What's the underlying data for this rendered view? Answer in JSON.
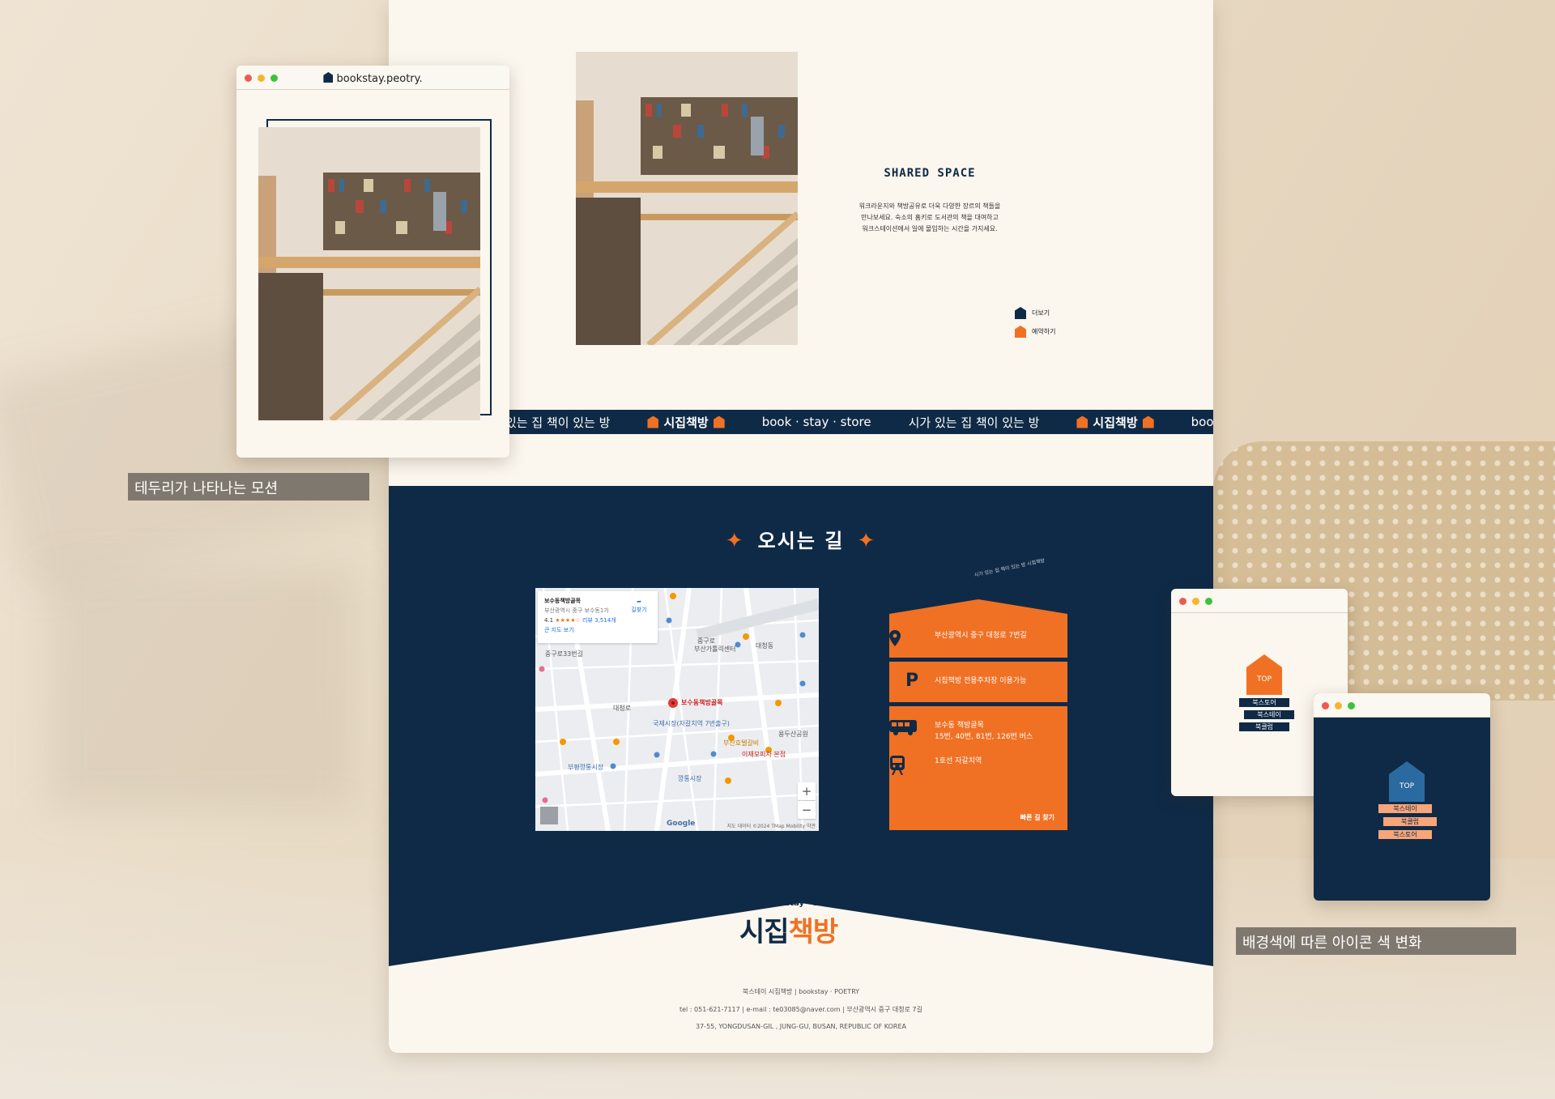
{
  "colors": {
    "navy": "#0f2a46",
    "orange": "#f07124",
    "cream": "#fbf6ee",
    "caption_bg": "#7f786e"
  },
  "shared": {
    "title": "SHARED SPACE",
    "desc": [
      "워크라운지와 책방공유로 더욱 다양한 장르의 책들을",
      "만나보세요. 숙소의 홈키로 도서관의 책을 대여하고",
      "워크스테이션에서 일에 몰입하는 시간을 가지세요."
    ],
    "more_label": "더보기",
    "reserve_label": "예약하기"
  },
  "ticker": {
    "items": [
      "있는 집 책이 있는 방",
      "시집책방",
      "book · stay · store",
      "시가 있는 집 책이 있는 방",
      "시집책방",
      "book · stay · s"
    ]
  },
  "directions": {
    "title": "오시는 길",
    "map": {
      "place_name": "보수동책방골목",
      "address": "부산광역시 중구 보수동1가",
      "rating": "4.1",
      "stars": "★★★★☆",
      "review_count": "리뷰 3,514개",
      "larger_map": "큰 지도 보기",
      "route_label": "길찾기",
      "pin_label": "보수동책방골목",
      "labels": [
        "대청로",
        "중구로",
        "부산가톨릭센터",
        "국제시장(자갈치역 7번출구)",
        "부산호텔갈비",
        "깡통시장",
        "부평깡통시장",
        "대청동",
        "중구로33번길",
        "이재모피자 본점",
        "용두산공원"
      ],
      "google": "Google",
      "footer": "지도 데이터 ©2024 TMap Mobility   약관"
    },
    "info": {
      "curve_text": "시가 있는 집 책이 있는 방 시집책방",
      "address": "부산광역시 중구 대청로 7번길",
      "parking": "시집책방 전용주차장 이용가능",
      "bus_stop": "보수동 책방골목",
      "bus_lines": "15번, 40번, 81번, 126번 버스",
      "subway": "1호선 자갈치역",
      "find_route": "빠른 길 찾기"
    }
  },
  "footer": {
    "logo_tag": "book · stay · store",
    "logo_name_a": "시집",
    "logo_name_b": "책방",
    "line1": "북스테이 시집책방  |  bookstay · POETRY",
    "line2": "tel : 051-621-7117  |  e-mail : te03085@naver.com  |  부산광역시 중구 대청로 7길",
    "line3": "37-55, YONGDUSAN-GIL , JUNG-GU, BUSAN, REPUBLIC OF KOREA"
  },
  "mock_left": {
    "url": "bookstay.peotry.",
    "caption": "테두리가 나타나는 모션"
  },
  "mock_right": {
    "top_label": "TOP",
    "light_menu": [
      "북스토어",
      "북스테이",
      "북클럽"
    ],
    "dark_menu": [
      "북스테이",
      "북클럽",
      "북스토어"
    ],
    "caption": "배경색에 따른 아이콘 색 변화"
  }
}
